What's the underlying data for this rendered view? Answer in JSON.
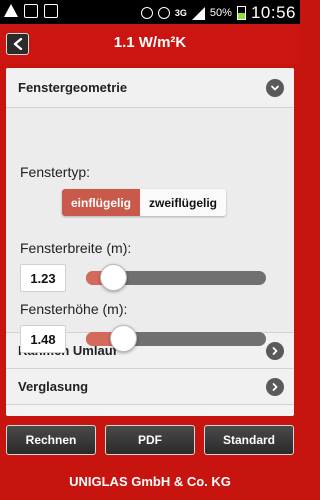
{
  "status_bar": {
    "battery": "50%",
    "network": "3G",
    "time": "10:56"
  },
  "header": {
    "title": "1.1 W/m²K",
    "back_icon": "back-arrow-icon"
  },
  "section_geometry": {
    "title": "Fenstergeometrie",
    "expanded": true,
    "window_type_label": "Fenstertyp:",
    "window_type_options": [
      "einflügelig",
      "zweiflügelig"
    ],
    "window_type_selected": "einflügelig",
    "width_label": "Fensterbreite (m):",
    "width_value": "1.23",
    "width_slider_fraction": 0.15,
    "height_label": "Fensterhöhe (m):",
    "height_value": "1.48",
    "height_slider_fraction": 0.21
  },
  "sections": [
    {
      "title": "Rahmen Umlauf"
    },
    {
      "title": "Verglasung"
    }
  ],
  "buttons": {
    "calculate": "Rechnen",
    "pdf": "PDF",
    "standard": "Standard"
  },
  "footer": {
    "company": "UNIGLAS GmbH & Co. KG"
  },
  "colors": {
    "brand_red": "#cc1510",
    "accent": "#c9594a",
    "slider_fill": "#d46a5c"
  }
}
